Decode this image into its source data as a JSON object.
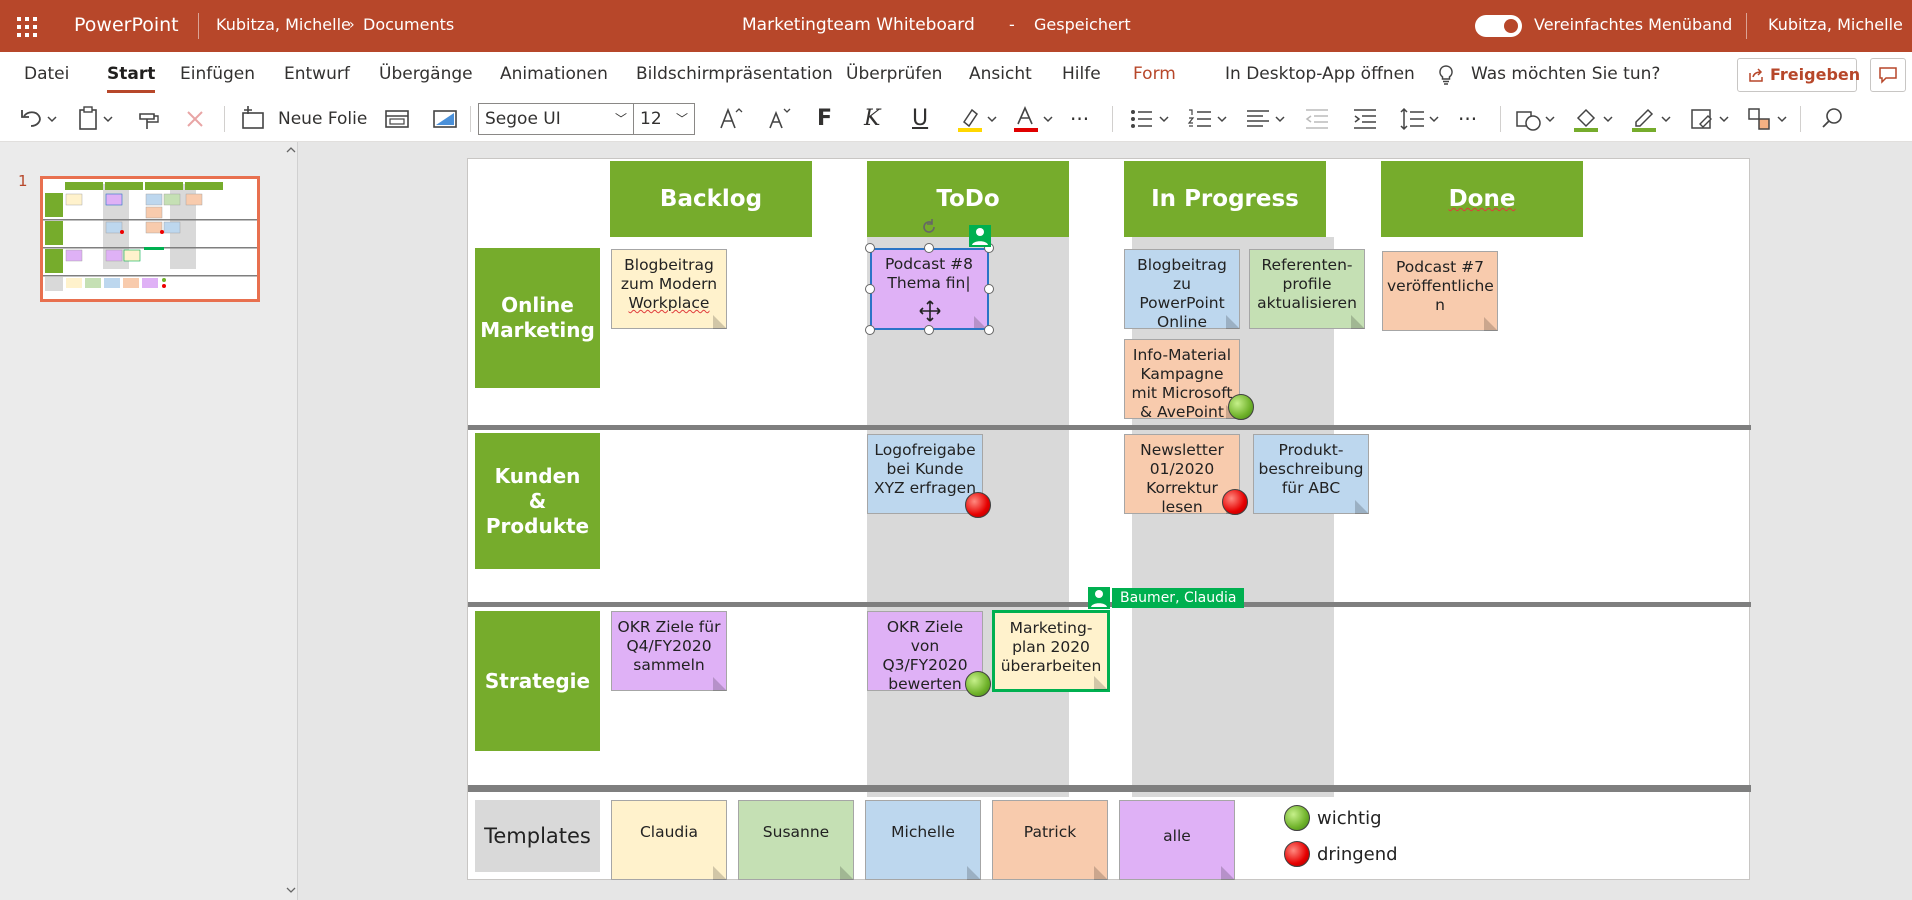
{
  "titlebar": {
    "app_name": "PowerPoint",
    "user_path": "Kubitza, Michelle",
    "folder": "Documents",
    "doc_title": "Marketingteam Whiteboard",
    "separator": "-",
    "save_status": "Gespeichert",
    "simplified_ribbon_label": "Vereinfachtes Menüband",
    "simplified_ribbon_on": true,
    "account_name": "Kubitza, Michelle"
  },
  "menu": {
    "items": [
      "Datei",
      "Start",
      "Einfügen",
      "Entwurf",
      "Übergänge",
      "Animationen",
      "Bildschirmpräsentation",
      "Überprüfen",
      "Ansicht",
      "Hilfe",
      "Form"
    ],
    "active": "Start",
    "desktop_app": "In Desktop-App öffnen",
    "tell_me": "Was möchten Sie tun?",
    "share": "Freigeben"
  },
  "toolbar": {
    "new_slide": "Neue Folie",
    "font_family": "Segoe UI",
    "font_size": "12",
    "bold": "F",
    "italic": "K",
    "underline": "U",
    "more": "···",
    "highlight_color": "#ffd700",
    "font_color": "#e00000"
  },
  "slides_panel": {
    "slide_number": "1"
  },
  "board": {
    "columns": [
      "Backlog",
      "ToDo",
      "In Progress",
      "Done"
    ],
    "rows": {
      "online_marketing": "Online Marketing",
      "kunden_1": "Kunden",
      "kunden_2": "&",
      "kunden_3": "Produkte",
      "strategie": "Strategie",
      "templates": "Templates"
    },
    "notes": {
      "n1": "Blogbeitrag zum Modern",
      "n1b": "Workplace",
      "n2": "Podcast #8 Thema fin|",
      "n3": "Blogbeitrag zu PowerPoint Online",
      "n4": "Referenten-profile aktualisieren",
      "n5": "Info-Material Kampagne mit Microsoft & AvePoint",
      "n6": "Podcast #7 veröffentliche n",
      "n7": "Logofreigabe bei Kunde XYZ erfragen",
      "n8": "Newsletter 01/2020 Korrektur lesen",
      "n9": "Produkt-beschreibung für ABC",
      "n10": "OKR Ziele für Q4/FY2020 sammeln",
      "n11": "OKR Ziele von Q3/FY2020 bewerten",
      "n12": "Marketing-plan 2020 überarbeiten"
    },
    "templates": [
      "Claudia",
      "Susanne",
      "Michelle",
      "Patrick",
      "alle"
    ],
    "legend": {
      "important": "wichtig",
      "urgent": "dringend"
    },
    "presence_user": "Baumer, Claudia",
    "colors": {
      "header_green": "#76ac2c",
      "yellow": "#fff2cc",
      "purple": "#dfb1f6",
      "blue": "#bdd7ee",
      "green": "#c5e0b4",
      "orange": "#f8cbad",
      "accent": "#b7472a"
    }
  }
}
